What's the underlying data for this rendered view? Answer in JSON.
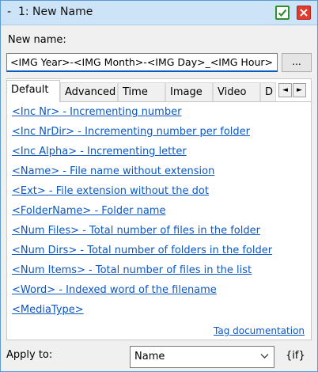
{
  "window": {
    "title": "-  1: New Name",
    "accept_icon": "checkmark-icon",
    "close_icon": "close-icon",
    "accept_color": "#2f8f2f",
    "close_color": "#e03b2f"
  },
  "form": {
    "new_name_label": "New name:",
    "new_name_value": "<IMG Year>-<IMG Month>-<IMG Day>_<IMG Hour>",
    "browse_label": "...",
    "apply_label": "Apply to:",
    "apply_value": "Name",
    "if_label": "{if}"
  },
  "tabs": [
    {
      "label": "Default",
      "active": true
    },
    {
      "label": "Advanced",
      "active": false
    },
    {
      "label": "Time",
      "active": false
    },
    {
      "label": "Image",
      "active": false
    },
    {
      "label": "Video",
      "active": false
    },
    {
      "label": "D",
      "active": false
    }
  ],
  "tab_scroll": {
    "left": "◄",
    "right": "►"
  },
  "tags": [
    "<Inc Nr> - Incrementing number",
    "<Inc NrDir> - Incrementing number per folder",
    "<Inc Alpha> - Incrementing letter",
    "<Name> - File name without extension",
    "<Ext> - File extension without the dot",
    "<FolderName> - Folder name",
    "<Num Files> - Total number of files in the folder",
    "<Num Dirs> - Total number of folders in the folder",
    "<Num Items> - Total number of files in the list",
    "<Word> - Indexed word of the filename",
    "<MediaType>"
  ],
  "tag_documentation_label": "Tag documentation",
  "colors": {
    "link": "#0a58c4",
    "titlebar": "#cde3f7"
  }
}
